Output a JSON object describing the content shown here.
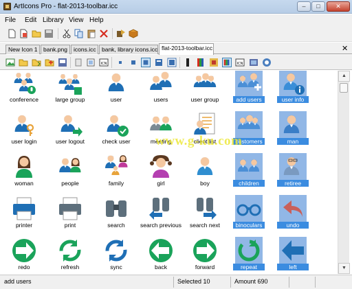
{
  "window": {
    "title": "ArtIcons Pro - flat-2013-toolbar.icc",
    "min": "–",
    "max": "□",
    "close": "✕"
  },
  "menu": [
    "File",
    "Edit",
    "Library",
    "View",
    "Help"
  ],
  "tabs": {
    "items": [
      "New Icon 1",
      "bank.png",
      "icons.icc",
      "bank, library icons.icc",
      "flat-2013-toolbar.icc"
    ],
    "active_index": 4,
    "close": "✕"
  },
  "icons": [
    {
      "label": "conference",
      "icon": "conference-icon",
      "selected": false
    },
    {
      "label": "large group",
      "icon": "large-group-icon",
      "selected": false
    },
    {
      "label": "user",
      "icon": "user-icon",
      "selected": false
    },
    {
      "label": "users",
      "icon": "users-icon",
      "selected": false
    },
    {
      "label": "user group",
      "icon": "user-group-icon",
      "selected": false
    },
    {
      "label": "add users",
      "icon": "add-users-icon",
      "selected": true
    },
    {
      "label": "user info",
      "icon": "user-info-icon",
      "selected": true
    },
    {
      "label": "user login",
      "icon": "user-login-icon",
      "selected": false
    },
    {
      "label": "user logout",
      "icon": "user-logout-icon",
      "selected": false
    },
    {
      "label": "check user",
      "icon": "check-user-icon",
      "selected": false
    },
    {
      "label": "meeting",
      "icon": "meeting-icon",
      "selected": false
    },
    {
      "label": "client list",
      "icon": "client-list-icon",
      "selected": false
    },
    {
      "label": "customers",
      "icon": "customers-icon",
      "selected": true
    },
    {
      "label": "man",
      "icon": "man-icon",
      "selected": true
    },
    {
      "label": "woman",
      "icon": "woman-icon",
      "selected": false
    },
    {
      "label": "people",
      "icon": "people-icon",
      "selected": false
    },
    {
      "label": "family",
      "icon": "family-icon",
      "selected": false
    },
    {
      "label": "girl",
      "icon": "girl-icon",
      "selected": false
    },
    {
      "label": "boy",
      "icon": "boy-icon",
      "selected": false
    },
    {
      "label": "children",
      "icon": "children-icon",
      "selected": true
    },
    {
      "label": "retiree",
      "icon": "retiree-icon",
      "selected": true
    },
    {
      "label": "printer",
      "icon": "printer-icon",
      "selected": false
    },
    {
      "label": "print",
      "icon": "print-icon",
      "selected": false
    },
    {
      "label": "search",
      "icon": "search-icon",
      "selected": false
    },
    {
      "label": "search previous",
      "icon": "search-previous-icon",
      "selected": false
    },
    {
      "label": "search next",
      "icon": "search-next-icon",
      "selected": false
    },
    {
      "label": "binoculars",
      "icon": "binoculars-icon",
      "selected": true
    },
    {
      "label": "undo",
      "icon": "undo-icon",
      "selected": true
    },
    {
      "label": "redo",
      "icon": "redo-icon",
      "selected": false
    },
    {
      "label": "refresh",
      "icon": "refresh-icon",
      "selected": false
    },
    {
      "label": "sync",
      "icon": "sync-icon",
      "selected": false
    },
    {
      "label": "back",
      "icon": "back-icon",
      "selected": false
    },
    {
      "label": "forward",
      "icon": "forward-icon",
      "selected": false
    },
    {
      "label": "repeat",
      "icon": "repeat-icon",
      "selected": true
    },
    {
      "label": "left",
      "icon": "left-arrow-icon",
      "selected": true
    }
  ],
  "status": {
    "item": "add users",
    "selected": "Selected 10",
    "amount": "Amount 690"
  },
  "watermark": "www.g-ku.com",
  "colors": {
    "accent": "#3b8ce0",
    "selection_bg": "#91b7e6",
    "blue": "#1f6fb5",
    "green": "#1aa35a",
    "skin": "#f5c8a0"
  }
}
